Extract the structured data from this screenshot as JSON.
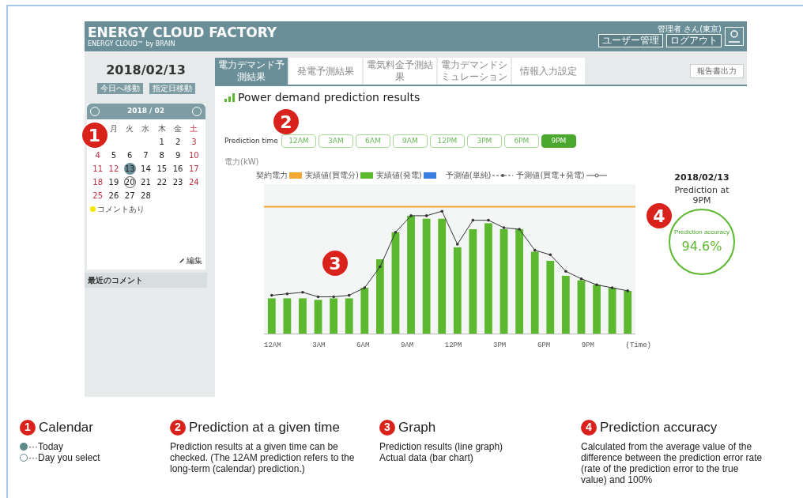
{
  "header": {
    "title": "ENERGY CLOUD FACTORY",
    "subtitle": "ENERGY CLOUD™ by BRAIN",
    "user": "管理者 さん(東京)",
    "buttons": [
      "ユーザー管理",
      "ログアウト"
    ]
  },
  "sidebar": {
    "date": "2018/02/13",
    "buttons": [
      "今日へ移動",
      "指定日移動"
    ],
    "calendar": {
      "month": "2018 / 02",
      "badge": "1",
      "weekdays": [
        {
          "label": "月",
          "holiday": false
        },
        {
          "label": "火",
          "holiday": false
        },
        {
          "label": "水",
          "holiday": false
        },
        {
          "label": "木",
          "holiday": false
        },
        {
          "label": "金",
          "holiday": false
        },
        {
          "label": "土",
          "holiday": true
        }
      ],
      "weeks": [
        [
          {
            "day": "1",
            "holiday": false,
            "today": false,
            "selected": false
          },
          {
            "day": "2",
            "holiday": false,
            "today": false,
            "selected": false
          },
          {
            "day": "3",
            "holiday": true,
            "today": false,
            "selected": false
          }
        ],
        [
          {
            "day": "4",
            "holiday": true,
            "today": false,
            "selected": false
          },
          {
            "day": "5",
            "holiday": false,
            "today": false,
            "selected": false
          },
          {
            "day": "6",
            "holiday": false,
            "today": false,
            "selected": false
          },
          {
            "day": "7",
            "holiday": false,
            "today": false,
            "selected": false
          },
          {
            "day": "8",
            "holiday": false,
            "today": false,
            "selected": false
          },
          {
            "day": "9",
            "holiday": false,
            "today": false,
            "selected": false
          },
          {
            "day": "10",
            "holiday": true,
            "today": false,
            "selected": false
          }
        ],
        [
          {
            "day": "11",
            "holiday": true,
            "today": false,
            "selected": false
          },
          {
            "day": "12",
            "holiday": true,
            "today": false,
            "selected": false
          },
          {
            "day": "13",
            "holiday": false,
            "today": true,
            "selected": false
          },
          {
            "day": "14",
            "holiday": false,
            "today": false,
            "selected": false
          },
          {
            "day": "15",
            "holiday": false,
            "today": false,
            "selected": false
          },
          {
            "day": "16",
            "holiday": false,
            "today": false,
            "selected": false
          },
          {
            "day": "17",
            "holiday": true,
            "today": false,
            "selected": false
          }
        ],
        [
          {
            "day": "18",
            "holiday": true,
            "today": false,
            "selected": false
          },
          {
            "day": "19",
            "holiday": false,
            "today": false,
            "selected": false
          },
          {
            "day": "20",
            "holiday": false,
            "today": false,
            "selected": true
          },
          {
            "day": "21",
            "holiday": false,
            "today": false,
            "selected": false
          },
          {
            "day": "22",
            "holiday": false,
            "today": false,
            "selected": false
          },
          {
            "day": "23",
            "holiday": false,
            "today": false,
            "selected": false
          },
          {
            "day": "24",
            "holiday": true,
            "today": false,
            "selected": false
          }
        ],
        [
          {
            "day": "25",
            "holiday": true,
            "today": false,
            "selected": false
          },
          {
            "day": "26",
            "holiday": false,
            "today": false,
            "selected": false
          },
          {
            "day": "27",
            "holiday": false,
            "today": false,
            "selected": false
          },
          {
            "day": "28",
            "holiday": false,
            "today": false,
            "selected": false
          }
        ]
      ],
      "comment_legend": "コメントあり",
      "edit": "編集"
    },
    "recent_comments": "最近のコメント"
  },
  "tabs": [
    {
      "label": "電力デマンド予測結果",
      "selected": true
    },
    {
      "label": "発電予測結果",
      "selected": false
    },
    {
      "label": "電気料金予測結果",
      "selected": false
    },
    {
      "label": "電力デマンドシミュレーション",
      "selected": false
    },
    {
      "label": "情報入力設定",
      "selected": false
    }
  ],
  "report_button": "報告書出力",
  "section_title": "Power demand prediction results",
  "prediction_time": {
    "label": "Prediction time",
    "badge": "2",
    "options": [
      {
        "label": "12AM",
        "selected": false
      },
      {
        "label": "3AM",
        "selected": false
      },
      {
        "label": "6AM",
        "selected": false
      },
      {
        "label": "9AM",
        "selected": false
      },
      {
        "label": "12PM",
        "selected": false
      },
      {
        "label": "3PM",
        "selected": false
      },
      {
        "label": "6PM",
        "selected": false
      },
      {
        "label": "9PM",
        "selected": true
      }
    ]
  },
  "graph": {
    "ylabel": "電力(kW)",
    "badge": "3",
    "legend": [
      {
        "label": "契約電力",
        "kind": "swatch",
        "color": "#f0a830"
      },
      {
        "label": "実績値(買電分)",
        "kind": "swatch",
        "color": "#5cb82e"
      },
      {
        "label": "実績値(発電)",
        "kind": "swatch",
        "color": "#3a7fe0"
      },
      {
        "label": "予測値(単純)",
        "kind": "dashed"
      },
      {
        "label": "予測値(買電+発電)",
        "kind": "solid"
      }
    ],
    "xlabels": [
      "12AM",
      "3AM",
      "6AM",
      "9AM",
      "12PM",
      "3PM",
      "6PM",
      "9PM",
      "(Time)"
    ]
  },
  "accuracy": {
    "date": "2018/02/13",
    "caption": "Prediction at 9PM",
    "badge": "4",
    "label": "Prediction accuracy",
    "value": "94.6%"
  },
  "legend": [
    {
      "badge": "1",
      "title": "Calendar",
      "lines": [
        {
          "kind": "today",
          "text": "···Today"
        },
        {
          "kind": "select",
          "text": "···Day you select"
        }
      ]
    },
    {
      "badge": "2",
      "title": "Prediction at a given time",
      "text": "Prediction results at a given time can be checked. (The 12AM prediction refers to the long-term (calendar) prediction.)"
    },
    {
      "badge": "3",
      "title": "Graph",
      "paragraphs": [
        "Prediction results (line graph)",
        "Actual data (bar chart)"
      ]
    },
    {
      "badge": "4",
      "title": "Prediction accuracy",
      "text": "Calculated from the average value of the difference between the prediction error rate (rate of the prediction error to the true value) and 100%"
    }
  ]
}
